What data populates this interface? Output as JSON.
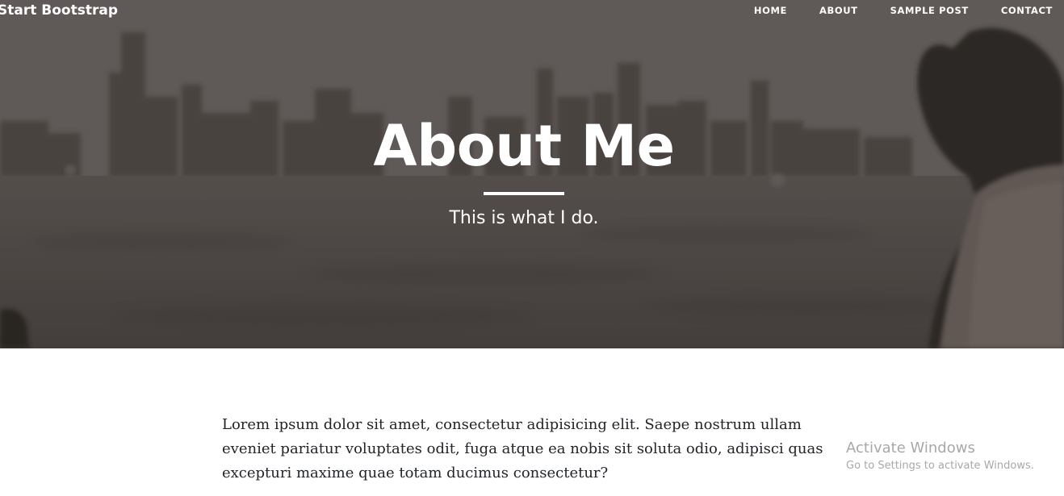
{
  "navbar": {
    "brand": "Start Bootstrap",
    "links": [
      {
        "label": "HOME"
      },
      {
        "label": "ABOUT"
      },
      {
        "label": "SAMPLE POST"
      },
      {
        "label": "CONTACT"
      }
    ]
  },
  "header": {
    "title": "About Me",
    "subtitle": "This is what I do."
  },
  "content": {
    "paragraph": "Lorem ipsum dolor sit amet, consectetur adipisicing elit. Saepe nostrum ullam eveniet pariatur voluptates odit, fuga atque ea nobis sit soluta odio, adipisci quas excepturi maxime quae totam ducimus consectetur?"
  },
  "watermark": {
    "title": "Activate Windows",
    "subtitle": "Go to Settings to activate Windows."
  },
  "colors": {
    "hero_tint": "#635d5a",
    "text_on_hero": "#ffffff",
    "body_text": "#212529",
    "watermark": "#a8a8a8"
  }
}
